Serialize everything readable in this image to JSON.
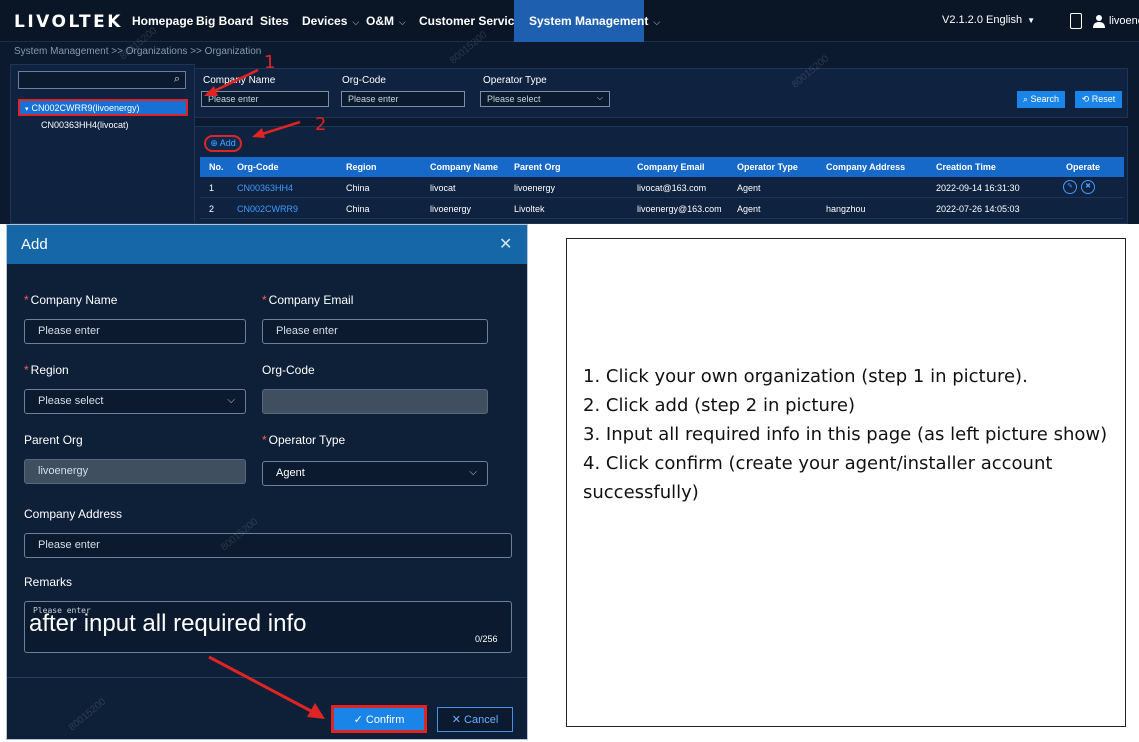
{
  "shot1": {
    "logo": "LIVOLTEK",
    "nav": {
      "homepage": "Homepage",
      "big_board": "Big Board",
      "sites": "Sites",
      "devices": "Devices",
      "om": "O&M",
      "customer_service": "Customer Service",
      "system_management": "System Management"
    },
    "version": "V2.1.2.0",
    "language": "English",
    "user": "livoenergy",
    "breadcrumb": "System Management >> Organizations >> Organization",
    "tree": {
      "search_icon": "search-icon",
      "nodes": [
        "CN002CWRR9(livoenergy)",
        "CN00363HH4(livocat)"
      ]
    },
    "filter": {
      "company_name_label": "Company Name",
      "company_name_placeholder": "Please enter",
      "org_code_label": "Org-Code",
      "org_code_placeholder": "Please enter",
      "operator_type_label": "Operator Type",
      "operator_type_placeholder": "Please select",
      "search_label": "Search",
      "reset_label": "Reset"
    },
    "add_label": "Add",
    "table": {
      "headers": [
        "No.",
        "Org-Code",
        "Region",
        "Company Name",
        "Parent Org",
        "Company Email",
        "Operator Type",
        "Company Address",
        "Creation Time",
        "Operate"
      ],
      "rows": [
        [
          "1",
          "CN00363HH4",
          "China",
          "livocat",
          "livoenergy",
          "livocat@163.com",
          "Agent",
          "",
          "2022-09-14 16:31:30"
        ],
        [
          "2",
          "CN002CWRR9",
          "China",
          "livoenergy",
          "Livoltek",
          "livoenergy@163.com",
          "Agent",
          "hangzhou",
          "2022-07-26 14:05:03"
        ]
      ]
    },
    "callouts": [
      "1",
      "2"
    ]
  },
  "dialog": {
    "title": "Add",
    "company_name_label": "Company Name",
    "company_name_placeholder": "Please enter",
    "company_email_label": "Company Email",
    "company_email_placeholder": "Please enter",
    "region_label": "Region",
    "region_placeholder": "Please select",
    "org_code_label": "Org-Code",
    "parent_org_label": "Parent Org",
    "parent_org_value": "livoenergy",
    "operator_type_label": "Operator Type",
    "operator_type_value": "Agent",
    "company_address_label": "Company Address",
    "company_address_placeholder": "Please enter",
    "remarks_label": "Remarks",
    "remarks_placeholder": "Please enter",
    "remarks_overlay": "after input all required info",
    "remarks_counter": "0/256",
    "confirm_label": "Confirm",
    "cancel_label": "Cancel"
  },
  "watermark": "80015200",
  "instructions": [
    "1. Click your own organization (step 1 in picture).",
    "2. Click add (step 2 in picture)",
    "3. Input all required info in this page (as left picture show)",
    "4. Click confirm (create your agent/installer account successfully)"
  ],
  "colors": {
    "accent": "#1b84e8",
    "highlight": "#e02424",
    "dialog_header": "#1567a8",
    "panel_bg": "#0f2240"
  }
}
